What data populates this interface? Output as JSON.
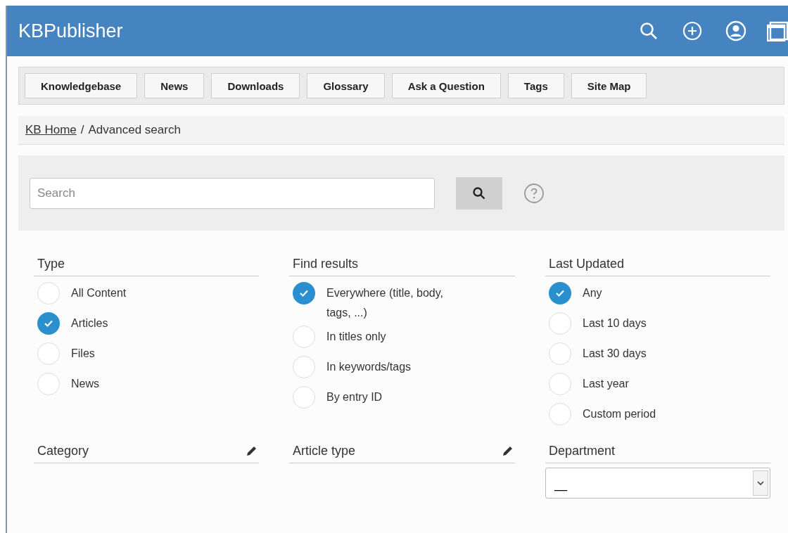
{
  "header": {
    "title": "KBPublisher"
  },
  "nav": [
    "Knowledgebase",
    "News",
    "Downloads",
    "Glossary",
    "Ask a Question",
    "Tags",
    "Site Map"
  ],
  "breadcrumb": {
    "home": "KB Home",
    "separator": "/",
    "current": "Advanced search"
  },
  "search": {
    "placeholder": "Search"
  },
  "groups": [
    {
      "title": "Type",
      "options": [
        {
          "label": "All Content",
          "selected": false
        },
        {
          "label": "Articles",
          "selected": true
        },
        {
          "label": "Files",
          "selected": false
        },
        {
          "label": "News",
          "selected": false
        }
      ]
    },
    {
      "title": "Find results",
      "options": [
        {
          "label": "Everywhere (title, body, tags, ...)",
          "selected": true
        },
        {
          "label": "In titles only",
          "selected": false
        },
        {
          "label": "In keywords/tags",
          "selected": false
        },
        {
          "label": "By entry ID",
          "selected": false
        }
      ]
    },
    {
      "title": "Last Updated",
      "options": [
        {
          "label": "Any",
          "selected": true
        },
        {
          "label": "Last 10 days",
          "selected": false
        },
        {
          "label": "Last 30 days",
          "selected": false
        },
        {
          "label": "Last year",
          "selected": false
        },
        {
          "label": "Custom period",
          "selected": false
        }
      ]
    }
  ],
  "filters": [
    {
      "title": "Category",
      "kind": "editable"
    },
    {
      "title": "Article type",
      "kind": "editable"
    },
    {
      "title": "Department",
      "kind": "select",
      "value": "__"
    }
  ]
}
